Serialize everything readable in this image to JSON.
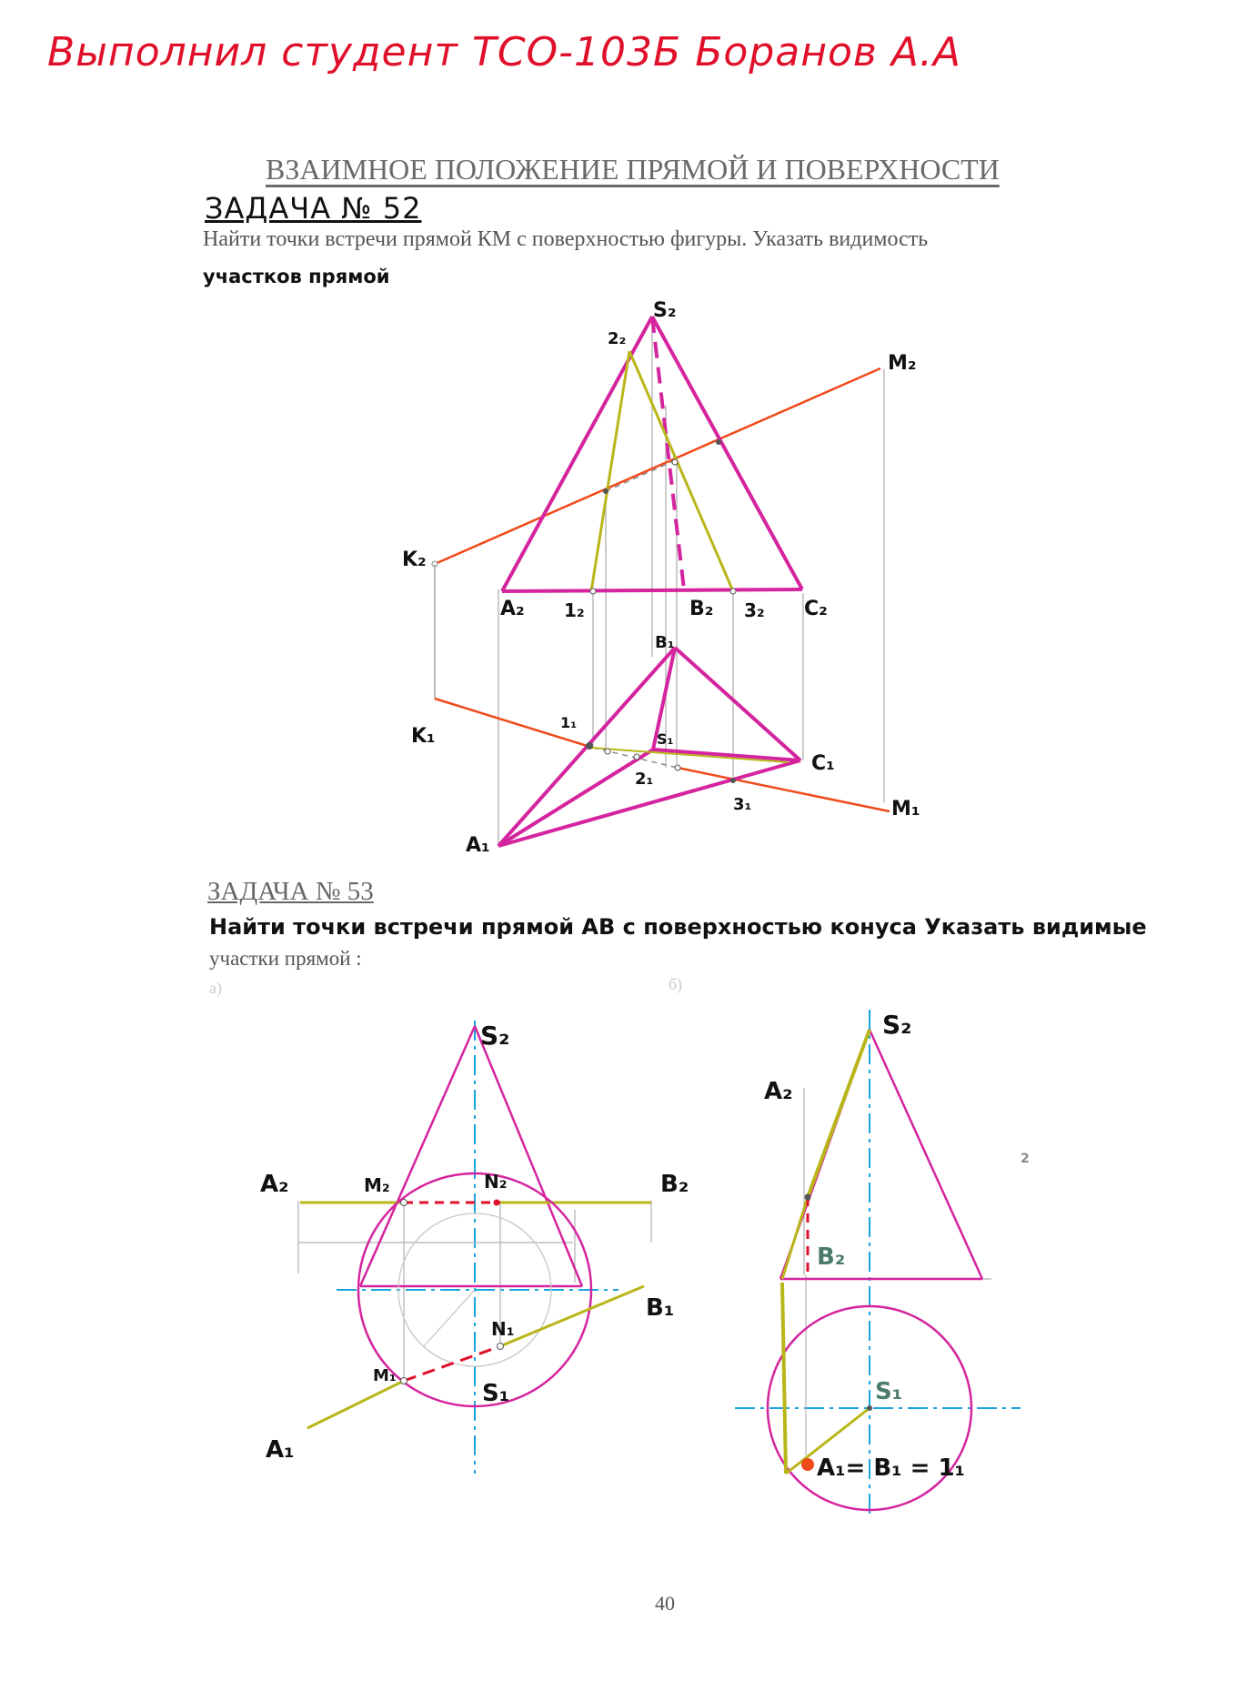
{
  "header": {
    "signature": "Выполнил студент ТСО-103Б Боранов А.А"
  },
  "section_title": "ВЗАИМНОЕ ПОЛОЖЕНИЕ ПРЯМОЙ И ПОВЕРХНОСТИ",
  "task52": {
    "title": "ЗАДАЧА № 52",
    "text_line1": "Найти точки встречи прямой КМ с поверхностью фигуры. Указать видимость",
    "text_line2": "участков прямой",
    "labels": {
      "S2": "S₂",
      "M2": "M₂",
      "K2": "K₂",
      "A2": "A₂",
      "B2": "B₂",
      "C2": "C₂",
      "p1_2": "1₂",
      "p2_2": "2₂",
      "p3_2": "3₂",
      "B1": "B₁",
      "K1": "K₁",
      "M1": "M₁",
      "A1": "A₁",
      "C1": "C₁",
      "S1": "S₁",
      "p1_1": "1₁",
      "p2_1": "2₁",
      "p3_1": "3₁"
    }
  },
  "task53": {
    "title": "ЗАДАЧА № 53",
    "text_line1": "Найти точки встречи прямой АВ с поверхностью конуса Указать видимые",
    "text_line2": "участки прямой :",
    "sub_a": "а)",
    "sub_b": "б)",
    "labels_a": {
      "S2": "S₂",
      "A2": "A₂",
      "M2": "M₂",
      "N2": "N₂",
      "B2": "B₂",
      "N1": "N₁",
      "B1": "B₁",
      "M1": "M₁",
      "S1": "S₁",
      "A1": "A₁"
    },
    "labels_b": {
      "S2": "S₂",
      "A2": "A₂",
      "B2": "B₂",
      "S1": "S₁",
      "A1B1": "A₁= B₁ = 1₁"
    },
    "stray_mark": "2"
  },
  "page_number": "40",
  "colors": {
    "magenta": "#d4249e",
    "yellow": "#b9b61a",
    "orange": "#f04a1a",
    "blue": "#1ba3e0",
    "red": "#e0102a",
    "gray": "#9a9a9a"
  }
}
